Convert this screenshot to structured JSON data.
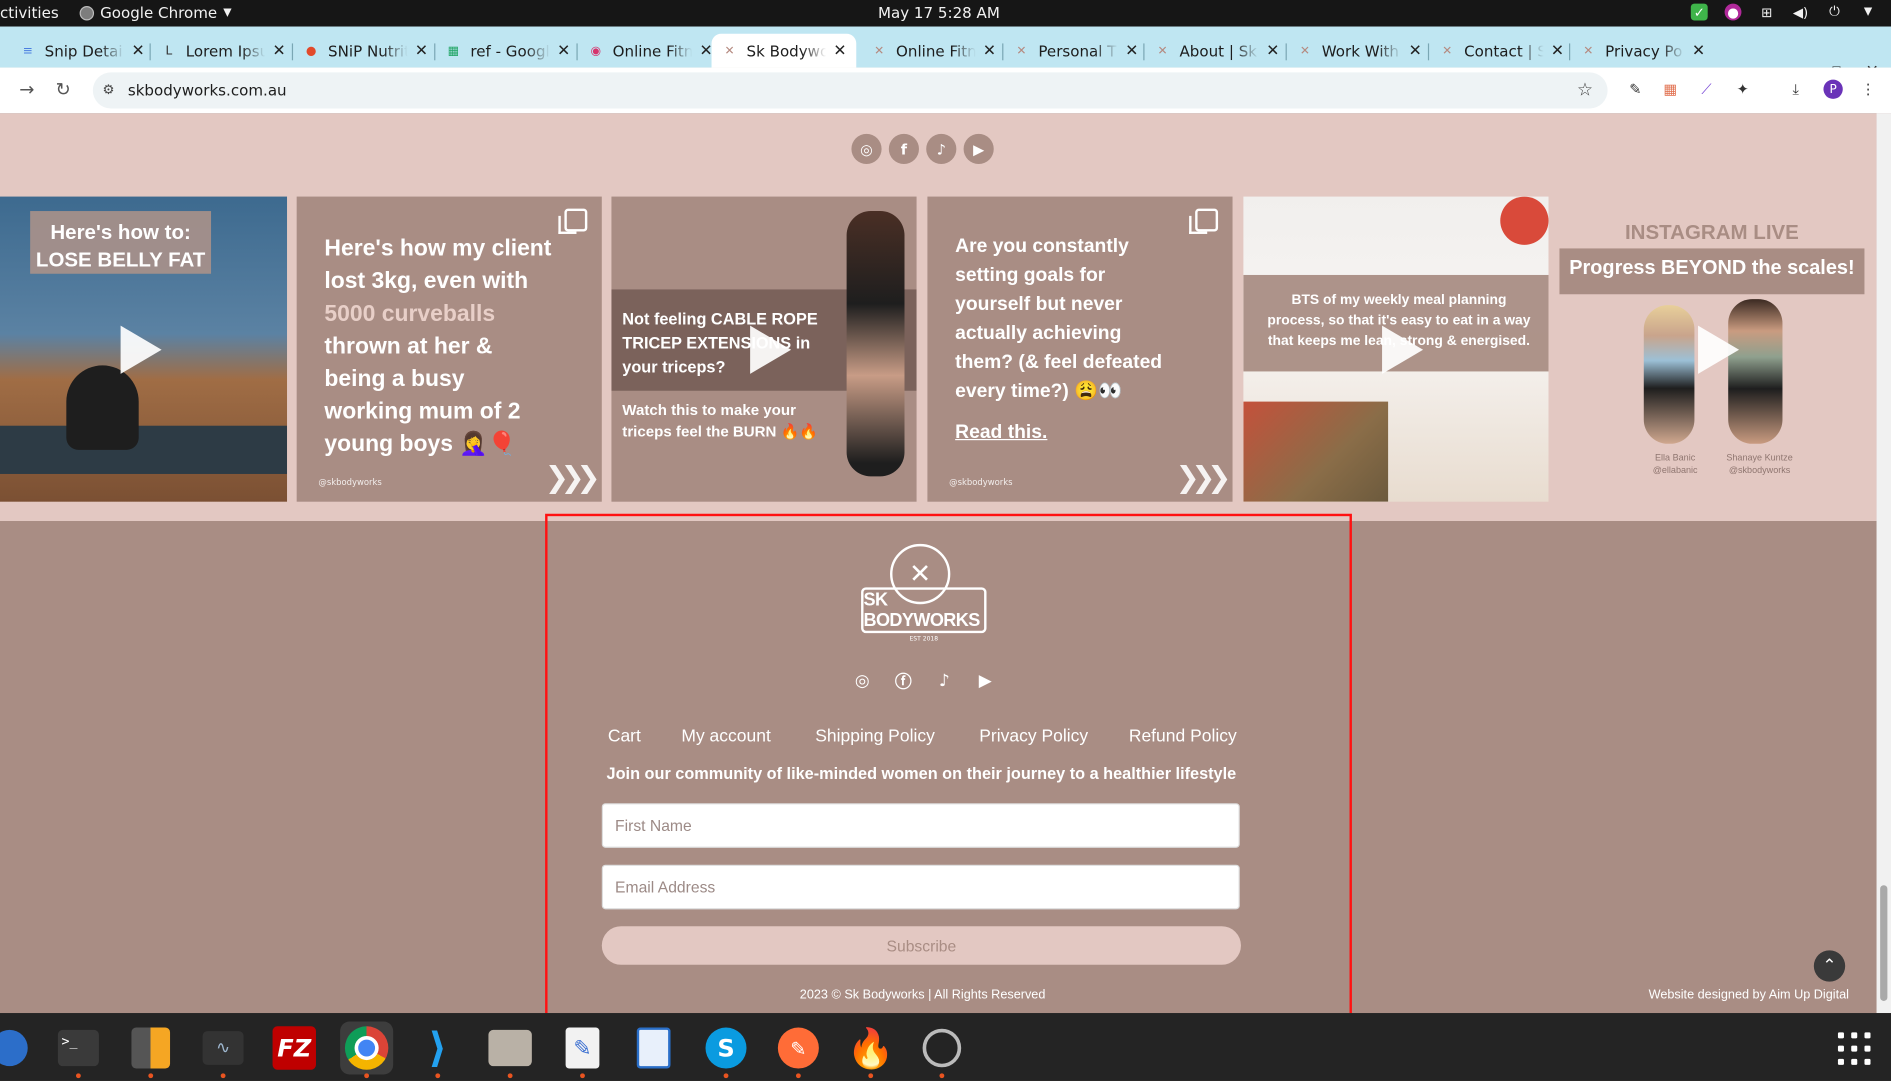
{
  "os": {
    "activities": "ctivities",
    "app_name": "Google Chrome",
    "clock": "May 17  5:28 AM"
  },
  "tabs": [
    {
      "label": "Snip Detai",
      "icon": "docs-icon",
      "color": "#4a7de0"
    },
    {
      "label": "Lorem Ipsu",
      "icon": "lorem-icon",
      "color": "#333333"
    },
    {
      "label": "SNiP Nutrit",
      "icon": "snip-icon",
      "color": "#e24a2b"
    },
    {
      "label": "ref - Googl",
      "icon": "sheets-icon",
      "color": "#1fa463"
    },
    {
      "label": "Online Fitn",
      "icon": "colorful-icon",
      "color": "#d6336c"
    },
    {
      "label": "Sk Bodywo",
      "icon": "skbodyworks-icon",
      "color": "#b58a80",
      "active": true
    },
    {
      "label": "Online Fitn",
      "icon": "skbodyworks-icon",
      "color": "#b58a80"
    },
    {
      "label": "Personal T",
      "icon": "skbodyworks-icon",
      "color": "#b58a80"
    },
    {
      "label": "About | Sk",
      "icon": "skbodyworks-icon",
      "color": "#b58a80"
    },
    {
      "label": "Work With",
      "icon": "skbodyworks-icon",
      "color": "#b58a80"
    },
    {
      "label": "Contact | S",
      "icon": "skbodyworks-icon",
      "color": "#b58a80"
    },
    {
      "label": "Privacy Po",
      "icon": "skbodyworks-icon",
      "color": "#b58a80"
    }
  ],
  "address_bar": {
    "url": "skbodyworks.com.au"
  },
  "instagram": {
    "tiles": [
      {
        "lines": [
          "Here's how to:",
          "LOSE BELLY FAT"
        ],
        "type": "video"
      },
      {
        "lines": [
          "Here's how my client",
          "lost 3kg, even with",
          "5000 curveballs",
          "thrown at her &",
          "being a busy",
          "working mum of 2",
          "young boys 🤦‍♀️🎈"
        ],
        "handle": "@skbodyworks",
        "type": "carousel"
      },
      {
        "lines": [
          "Not feeling CABLE ROPE",
          "TRICEP EXTENSIONS in",
          "your triceps?"
        ],
        "sub": [
          "Watch this to make your",
          "triceps feel the BURN 🔥🔥"
        ],
        "type": "video"
      },
      {
        "lines": [
          "Are you constantly",
          "setting goals for",
          "yourself but never",
          "actually achieving",
          "them? (& feel defeated",
          "every time?) 😩👀"
        ],
        "cta": "Read this.",
        "handle": "@skbodyworks",
        "type": "carousel"
      },
      {
        "lines": [
          "BTS of my weekly meal planning",
          "process, so that it's easy to eat in a way",
          "that keeps me lean, strong & energised."
        ],
        "type": "video"
      },
      {
        "heading": "INSTAGRAM LIVE",
        "banner": "Progress BEYOND the scales!",
        "names": [
          "Ella Banic",
          "@ellabanic",
          "Shanaye Kuntze",
          "@skbodyworks"
        ],
        "type": "video"
      }
    ]
  },
  "footer": {
    "logo_text": "SK BODYWORKS",
    "logo_sub": "EST 2018",
    "links": [
      "Cart",
      "My account",
      "Shipping Policy",
      "Privacy Policy",
      "Refund Policy"
    ],
    "tagline": "Join our community of like-minded women on their journey to a healthier lifestyle",
    "first_name_placeholder": "First Name",
    "email_placeholder": "Email Address",
    "subscribe_label": "Subscribe",
    "copyright": "2023 © Sk Bodyworks | All Rights Reserved",
    "credit": "Website designed by Aim Up Digital"
  },
  "colors": {
    "brand_dusty_rose": "#a98d84",
    "band_light_pink": "#e3c8c2",
    "highlight_box": "#ff1111"
  }
}
